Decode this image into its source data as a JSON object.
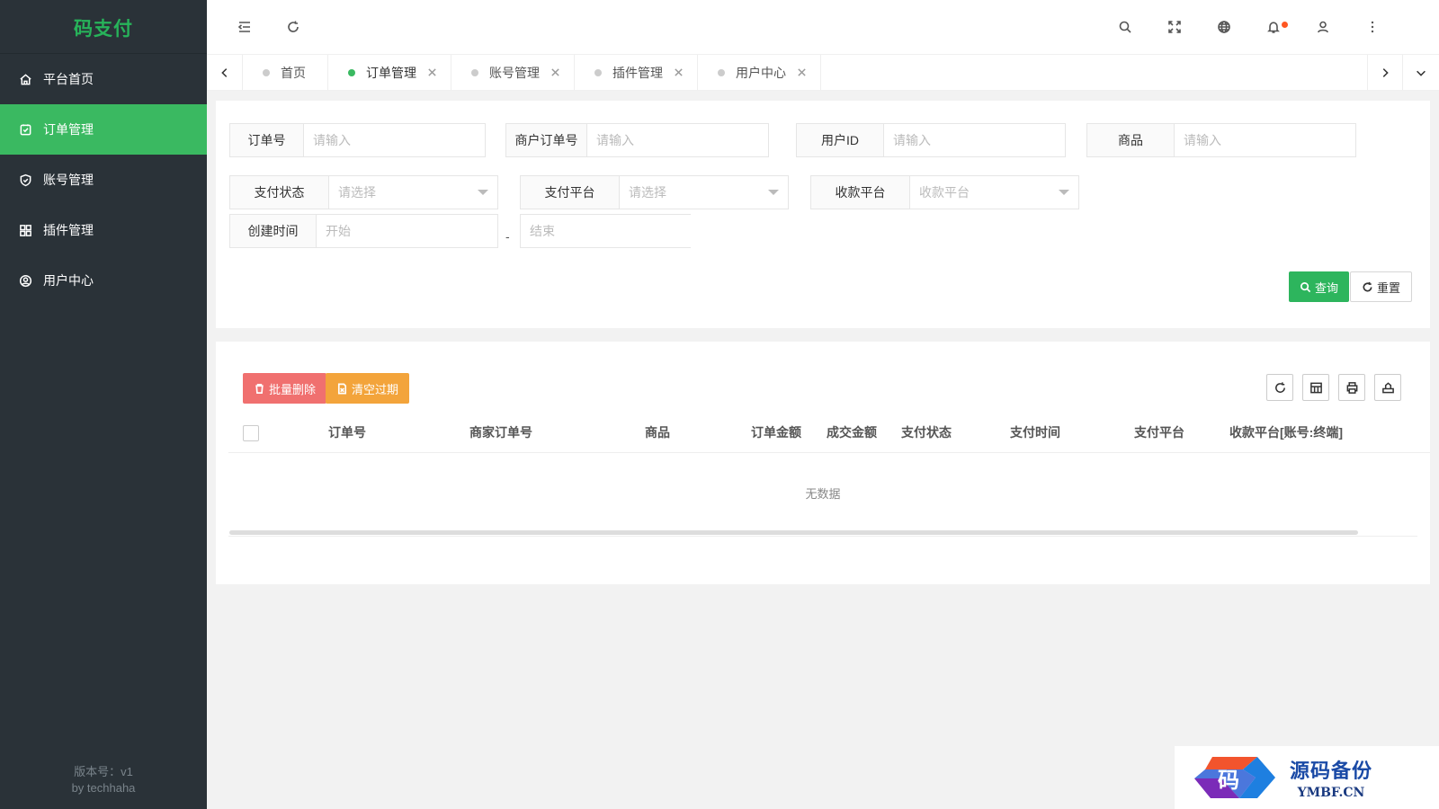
{
  "app": {
    "logo_text": "码支付",
    "version_text": "版本号：v1",
    "author_text": "by techhaha"
  },
  "sidebar": {
    "items": [
      {
        "label": "平台首页",
        "icon": "home-icon",
        "active": false
      },
      {
        "label": "订单管理",
        "icon": "order-icon",
        "active": true
      },
      {
        "label": "账号管理",
        "icon": "shield-icon",
        "active": false
      },
      {
        "label": "插件管理",
        "icon": "grid-icon",
        "active": false
      },
      {
        "label": "用户中心",
        "icon": "user-circle-icon",
        "active": false
      }
    ]
  },
  "header": {
    "left_icons": [
      "menu-fold-icon",
      "refresh-icon"
    ],
    "right_icons": [
      "search-icon",
      "fullscreen-icon",
      "globe-icon",
      "bell-icon",
      "user-icon",
      "more-vertical-icon"
    ]
  },
  "tabs": [
    {
      "label": "首页",
      "closable": false,
      "active": false
    },
    {
      "label": "订单管理",
      "closable": true,
      "active": true
    },
    {
      "label": "账号管理",
      "closable": true,
      "active": false
    },
    {
      "label": "插件管理",
      "closable": true,
      "active": false
    },
    {
      "label": "用户中心",
      "closable": true,
      "active": false
    }
  ],
  "search": {
    "order_no": {
      "label": "订单号",
      "placeholder": "请输入",
      "value": ""
    },
    "merchant_order_no": {
      "label": "商户订单号",
      "placeholder": "请输入",
      "value": ""
    },
    "user_id": {
      "label": "用户ID",
      "placeholder": "请输入",
      "value": ""
    },
    "goods": {
      "label": "商品",
      "placeholder": "请输入",
      "value": ""
    },
    "pay_status": {
      "label": "支付状态",
      "placeholder": "请选择"
    },
    "pay_platform": {
      "label": "支付平台",
      "placeholder": "请选择"
    },
    "receive_platform": {
      "label": "收款平台",
      "placeholder": "收款平台"
    },
    "create_time": {
      "label": "创建时间",
      "start_placeholder": "开始",
      "end_placeholder": "结束",
      "separator": "-"
    },
    "query_label": "查询",
    "reset_label": "重置"
  },
  "table": {
    "batch_delete_label": "批量删除",
    "clear_expired_label": "清空过期",
    "tool_icons": [
      "refresh-icon",
      "columns-icon",
      "print-icon",
      "export-icon"
    ],
    "columns": [
      "订单号",
      "商家订单号",
      "商品",
      "订单金额",
      "成交金额",
      "支付状态",
      "支付时间",
      "支付平台",
      "收款平台[账号:终端]"
    ],
    "rows": [],
    "empty_text": "无数据"
  },
  "watermark": {
    "logo_char": "码",
    "cn_text": "源码备份",
    "en_text": "YMBF.CN"
  },
  "colors": {
    "sidebar_bg": "#2a3238",
    "accent_green": "#3ab961",
    "danger": "#f0706f",
    "warning": "#f3a43b",
    "badge": "#ff5722"
  }
}
